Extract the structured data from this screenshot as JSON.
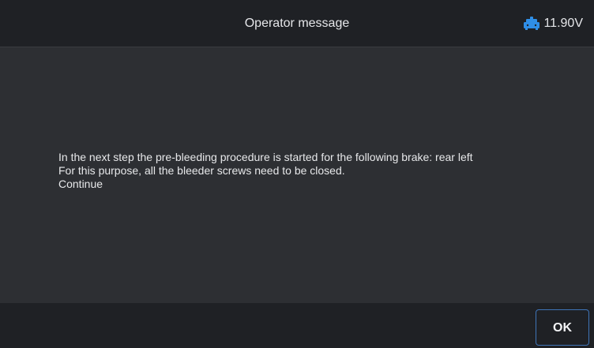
{
  "header": {
    "title": "Operator message",
    "battery": {
      "icon": "car-battery-icon",
      "value": "11.90V",
      "accent_color": "#2f8ee6"
    }
  },
  "message": {
    "lines": [
      "In the next step the pre-bleeding procedure is started for the following brake:  rear left",
      "For this purpose, all the bleeder screws need to be closed.",
      "Continue"
    ]
  },
  "footer": {
    "ok_label": "OK"
  },
  "colors": {
    "background": "#2d2f33",
    "bar": "#1f2125",
    "button_border": "#3f74b7",
    "text": "#e7e8ea"
  }
}
